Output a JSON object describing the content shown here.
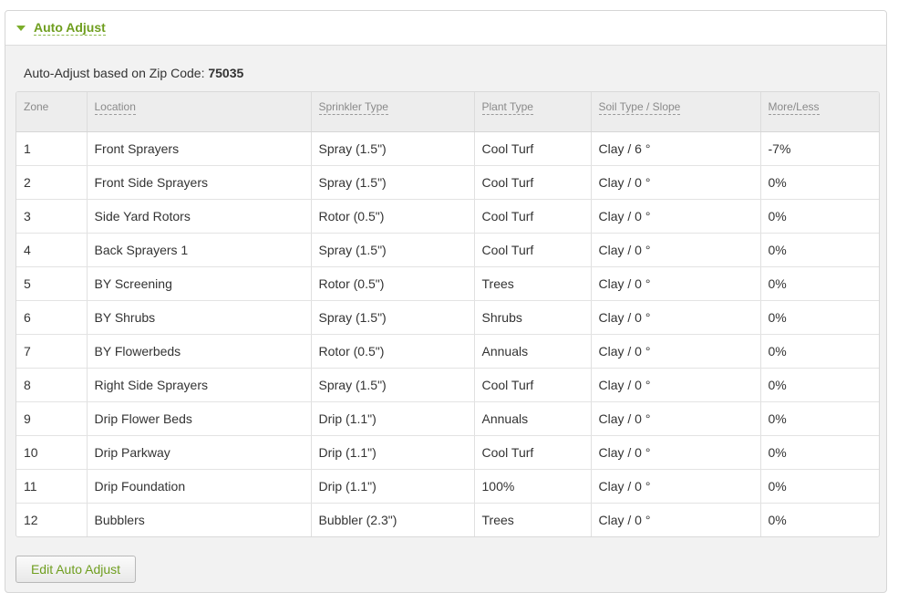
{
  "panel": {
    "title": "Auto Adjust",
    "zip_label": "Auto-Adjust based on Zip Code: ",
    "zip_code": "75035",
    "edit_button": "Edit Auto Adjust"
  },
  "table": {
    "headers": [
      "Zone",
      "Location",
      "Sprinkler Type",
      "Plant Type",
      "Soil Type / Slope",
      "More/Less"
    ],
    "rows": [
      [
        "1",
        "Front Sprayers",
        "Spray (1.5\")",
        "Cool Turf",
        "Clay / 6 °",
        "-7%"
      ],
      [
        "2",
        "Front Side Sprayers",
        "Spray (1.5\")",
        "Cool Turf",
        "Clay / 0 °",
        "0%"
      ],
      [
        "3",
        "Side Yard Rotors",
        "Rotor (0.5\")",
        "Cool Turf",
        "Clay / 0 °",
        "0%"
      ],
      [
        "4",
        "Back Sprayers 1",
        "Spray (1.5\")",
        "Cool Turf",
        "Clay / 0 °",
        "0%"
      ],
      [
        "5",
        "BY Screening",
        "Rotor (0.5\")",
        "Trees",
        "Clay / 0 °",
        "0%"
      ],
      [
        "6",
        "BY Shrubs",
        "Spray (1.5\")",
        "Shrubs",
        "Clay / 0 °",
        "0%"
      ],
      [
        "7",
        "BY Flowerbeds",
        "Rotor (0.5\")",
        "Annuals",
        "Clay / 0 °",
        "0%"
      ],
      [
        "8",
        "Right Side Sprayers",
        "Spray (1.5\")",
        "Cool Turf",
        "Clay / 0 °",
        "0%"
      ],
      [
        "9",
        "Drip Flower Beds",
        "Drip (1.1\")",
        "Annuals",
        "Clay / 0 °",
        "0%"
      ],
      [
        "10",
        "Drip Parkway",
        "Drip (1.1\")",
        "Cool Turf",
        "Clay / 0 °",
        "0%"
      ],
      [
        "11",
        "Drip Foundation",
        "Drip (1.1\")",
        "100%",
        "Clay / 0 °",
        "0%"
      ],
      [
        "12",
        "Bubblers",
        "Bubbler (2.3\")",
        "Trees",
        "Clay / 0 °",
        "0%"
      ]
    ]
  },
  "colors": {
    "accent": "#6f9e1f",
    "panel_bg": "#f2f2f2",
    "header_bg": "#ededed"
  },
  "icons": {
    "collapse": "caret-down-icon"
  }
}
